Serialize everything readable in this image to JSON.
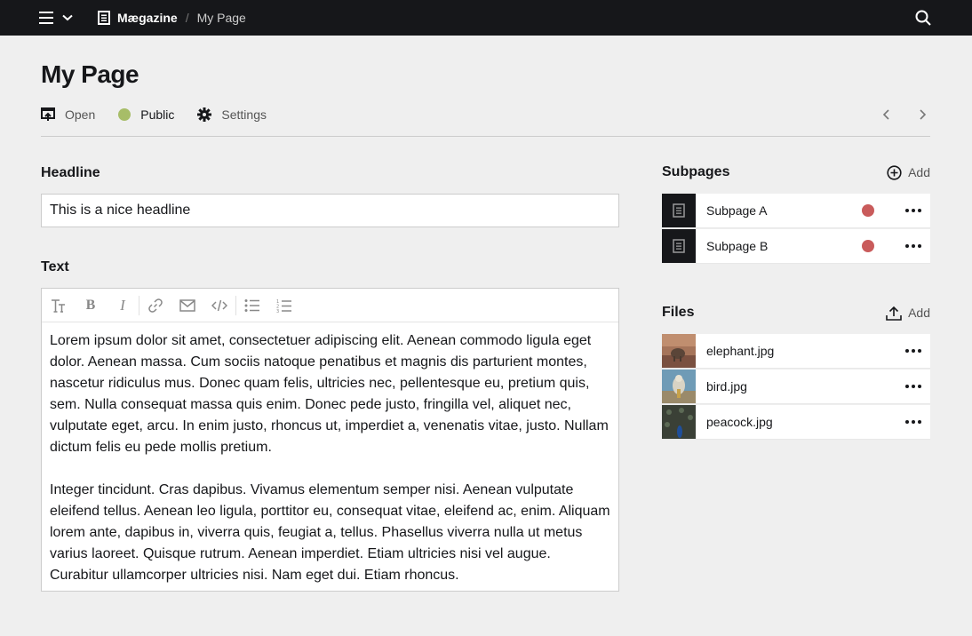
{
  "topbar": {
    "site": "Mægazine",
    "page": "My Page"
  },
  "header": {
    "title": "My Page",
    "open_label": "Open",
    "status_label": "Public",
    "settings_label": "Settings"
  },
  "fields": {
    "headline_label": "Headline",
    "headline_value": "This is a nice headline",
    "text_label": "Text",
    "text_paragraphs": [
      "Lorem ipsum dolor sit amet, consectetuer adipiscing elit. Aenean commodo ligula eget dolor. Aenean massa. Cum sociis natoque penatibus et magnis dis parturient montes, nascetur ridiculus mus. Donec quam felis, ultricies nec, pellentesque eu, pretium quis, sem. Nulla consequat massa quis enim. Donec pede justo, fringilla vel, aliquet nec, vulputate eget, arcu. In enim justo, rhoncus ut, imperdiet a, venenatis vitae, justo. Nullam dictum felis eu pede mollis pretium.",
      "Integer tincidunt. Cras dapibus. Vivamus elementum semper nisi. Aenean vulputate eleifend tellus. Aenean leo ligula, porttitor eu, consequat vitae, eleifend ac, enim. Aliquam lorem ante, dapibus in, viverra quis, feugiat a, tellus. Phasellus viverra nulla ut metus varius laoreet. Quisque rutrum. Aenean imperdiet. Etiam ultricies nisi vel augue. Curabitur ullamcorper ultricies nisi. Nam eget dui. Etiam rhoncus."
    ]
  },
  "subpages": {
    "title": "Subpages",
    "add_label": "Add",
    "items": [
      {
        "label": "Subpage A",
        "status_color": "#c95b5b"
      },
      {
        "label": "Subpage B",
        "status_color": "#c95b5b"
      }
    ]
  },
  "files": {
    "title": "Files",
    "add_label": "Add",
    "items": [
      {
        "label": "elephant.jpg"
      },
      {
        "label": "bird.jpg"
      },
      {
        "label": "peacock.jpg"
      }
    ]
  },
  "colors": {
    "topbar": "#16171a",
    "background": "#efefef",
    "status_public": "#a7bd68",
    "status_draft": "#c95b5b"
  }
}
